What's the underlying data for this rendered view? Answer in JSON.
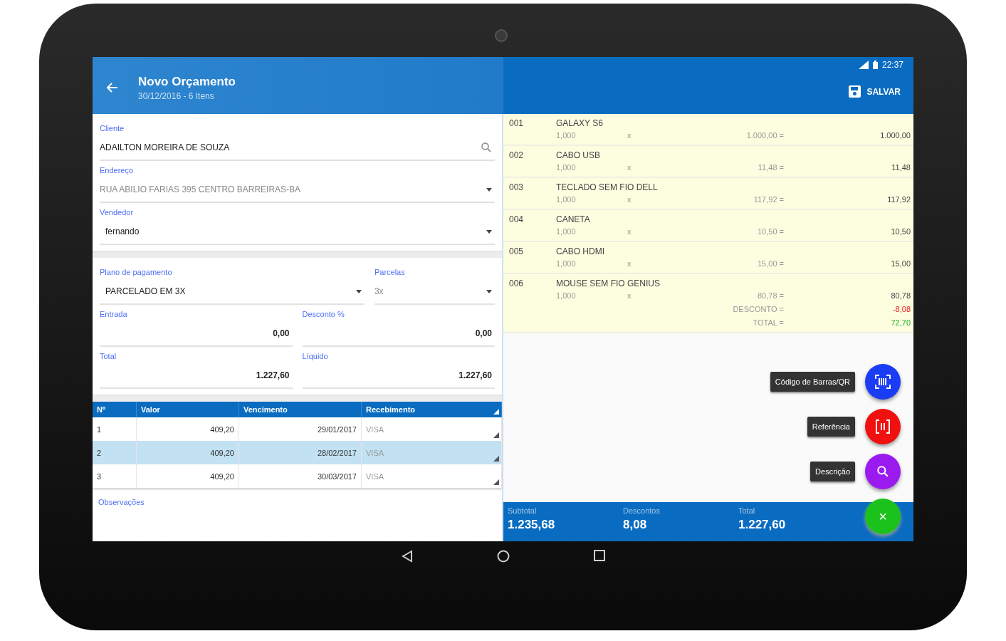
{
  "status_bar": {
    "time": "22:37"
  },
  "header": {
    "title": "Novo Orçamento",
    "subtitle": "30/12/2016 - 6 Itens",
    "action": "SALVAR"
  },
  "form_rows": [
    [
      {
        "label": "Cliente",
        "value": "ADAILTON MOREIRA DE SOUZA",
        "kind": "search",
        "disabled": false
      }
    ],
    [
      {
        "label": "Endereço",
        "value": "RUA ABILIO FARIAS 395 CENTRO BARREIRAS-BA",
        "kind": "dropdown",
        "disabled": true
      }
    ],
    [
      {
        "label": "Vendedor",
        "value": "fernando",
        "kind": "dropdown",
        "disabled": false
      }
    ],
    [
      {
        "label": "Plano de pagamento",
        "value": "PARCELADO EM 3X",
        "kind": "dropdown",
        "disabled": false
      },
      {
        "label": "Parcelas",
        "value": "3x",
        "kind": "dropdown",
        "disabled": true
      }
    ],
    [
      {
        "label": "Entrada",
        "value": "0,00",
        "kind": "number",
        "disabled": false
      },
      {
        "label": "Desconto %",
        "value": "0,00",
        "kind": "number",
        "disabled": false
      }
    ],
    [
      {
        "label": "Total",
        "value": "1.227,60",
        "kind": "number",
        "disabled": false
      },
      {
        "label": "Líquido",
        "value": "1.227,60",
        "kind": "number",
        "disabled": false
      }
    ]
  ],
  "installments": {
    "columns": [
      "Nº",
      "Valor",
      "Vencimento",
      "Recebimento"
    ],
    "rows": [
      {
        "cells": [
          "1",
          "409,20",
          "29/01/2017",
          "VISA"
        ],
        "selected": false
      },
      {
        "cells": [
          "2",
          "409,20",
          "28/02/2017",
          "VISA"
        ],
        "selected": true
      },
      {
        "cells": [
          "3",
          "409,20",
          "30/03/2017",
          "VISA"
        ],
        "selected": false
      }
    ]
  },
  "notes_label": "Observações",
  "items": [
    {
      "code": "001",
      "name": "GALAXY S6",
      "qty": "1,000",
      "sign": "x",
      "price": "1.000,00 =",
      "total": "1.000,00"
    },
    {
      "code": "002",
      "name": "CABO USB",
      "qty": "1,000",
      "sign": "x",
      "price": "11,48 =",
      "total": "11,48"
    },
    {
      "code": "003",
      "name": "TECLADO SEM FIO DELL",
      "qty": "1,000",
      "sign": "x",
      "price": "117,92 =",
      "total": "117,92"
    },
    {
      "code": "004",
      "name": "CANETA",
      "qty": "1,000",
      "sign": "x",
      "price": "10,50 =",
      "total": "10,50"
    },
    {
      "code": "005",
      "name": "CABO HDMI",
      "qty": "1,000",
      "sign": "x",
      "price": "15,00 =",
      "total": "15,00"
    },
    {
      "code": "006",
      "name": "MOUSE SEM FIO GENIUS",
      "qty": "1,000",
      "sign": "x",
      "price": "80,78 =",
      "total": "80,78",
      "extra_lines": [
        {
          "label": "DESCONTO =",
          "value": "-8,08",
          "kind": "discount"
        },
        {
          "label": "TOTAL =",
          "value": "72,70",
          "kind": "total"
        }
      ]
    }
  ],
  "fab_actions": [
    {
      "label": "Código de Barras/QR",
      "kind": "barcode",
      "color": "#1a3cf5"
    },
    {
      "label": "Referência",
      "kind": "reference",
      "color": "#f01010"
    },
    {
      "label": "Descrição",
      "kind": "search",
      "color": "#9a1af0"
    }
  ],
  "close_fab": {
    "symbol": "×",
    "color": "#1cc21c"
  },
  "totals": [
    {
      "label": "Subtotal",
      "value": "1.235,68"
    },
    {
      "label": "Descontos",
      "value": "8,08"
    },
    {
      "label": "Total",
      "value": "1.227,60"
    }
  ]
}
